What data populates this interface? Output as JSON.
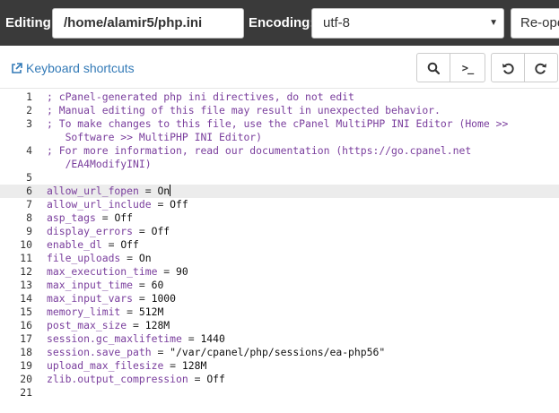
{
  "toolbar": {
    "editing_label": "Editing:",
    "file_path": "/home/alamir5/php.ini",
    "encoding_label": "Encoding:",
    "encoding_value": "utf-8",
    "reopen_label": "Re-open",
    "background_color": "#3a3a3a"
  },
  "subtoolbar": {
    "keyboard_shortcuts_label": "Keyboard shortcuts",
    "link_color": "#337ab7",
    "buttons": {
      "search_icon": "search-icon",
      "terminal_icon": "terminal-icon",
      "terminal_glyph": ">_",
      "undo_icon": "undo-icon",
      "redo_icon": "redo-icon"
    }
  },
  "editor": {
    "cursor_line": 6,
    "comment_color": "#7a3e9d",
    "lines": [
      {
        "num": "1",
        "kind": "comment",
        "rows": [
          "; cPanel-generated php ini directives, do not edit"
        ]
      },
      {
        "num": "2",
        "kind": "comment",
        "rows": [
          "; Manual editing of this file may result in unexpected behavior."
        ]
      },
      {
        "num": "3",
        "kind": "comment",
        "rows": [
          "; To make changes to this file, use the cPanel MultiPHP INI Editor (Home >>",
          "   Software >> MultiPHP INI Editor)"
        ]
      },
      {
        "num": "4",
        "kind": "comment",
        "rows": [
          "; For more information, read our documentation (https://go.cpanel.net",
          "   /EA4ModifyINI)"
        ]
      },
      {
        "num": "5",
        "kind": "blank",
        "rows": [
          ""
        ]
      },
      {
        "num": "6",
        "kind": "setting",
        "key": "allow_url_fopen",
        "value": "On"
      },
      {
        "num": "7",
        "kind": "setting",
        "key": "allow_url_include",
        "value": "Off"
      },
      {
        "num": "8",
        "kind": "setting",
        "key": "asp_tags",
        "value": "Off"
      },
      {
        "num": "9",
        "kind": "setting",
        "key": "display_errors",
        "value": "Off"
      },
      {
        "num": "10",
        "kind": "setting",
        "key": "enable_dl",
        "value": "Off"
      },
      {
        "num": "11",
        "kind": "setting",
        "key": "file_uploads",
        "value": "On"
      },
      {
        "num": "12",
        "kind": "setting",
        "key": "max_execution_time",
        "value": "90"
      },
      {
        "num": "13",
        "kind": "setting",
        "key": "max_input_time",
        "value": "60"
      },
      {
        "num": "14",
        "kind": "setting",
        "key": "max_input_vars",
        "value": "1000"
      },
      {
        "num": "15",
        "kind": "setting",
        "key": "memory_limit",
        "value": "512M"
      },
      {
        "num": "16",
        "kind": "setting",
        "key": "post_max_size",
        "value": "128M"
      },
      {
        "num": "17",
        "kind": "setting",
        "key": "session.gc_maxlifetime",
        "value": "1440"
      },
      {
        "num": "18",
        "kind": "setting",
        "key": "session.save_path",
        "value": "\"/var/cpanel/php/sessions/ea-php56\""
      },
      {
        "num": "19",
        "kind": "setting",
        "key": "upload_max_filesize",
        "value": "128M"
      },
      {
        "num": "20",
        "kind": "setting",
        "key": "zlib.output_compression",
        "value": "Off"
      },
      {
        "num": "21",
        "kind": "blank",
        "rows": [
          ""
        ]
      }
    ]
  }
}
